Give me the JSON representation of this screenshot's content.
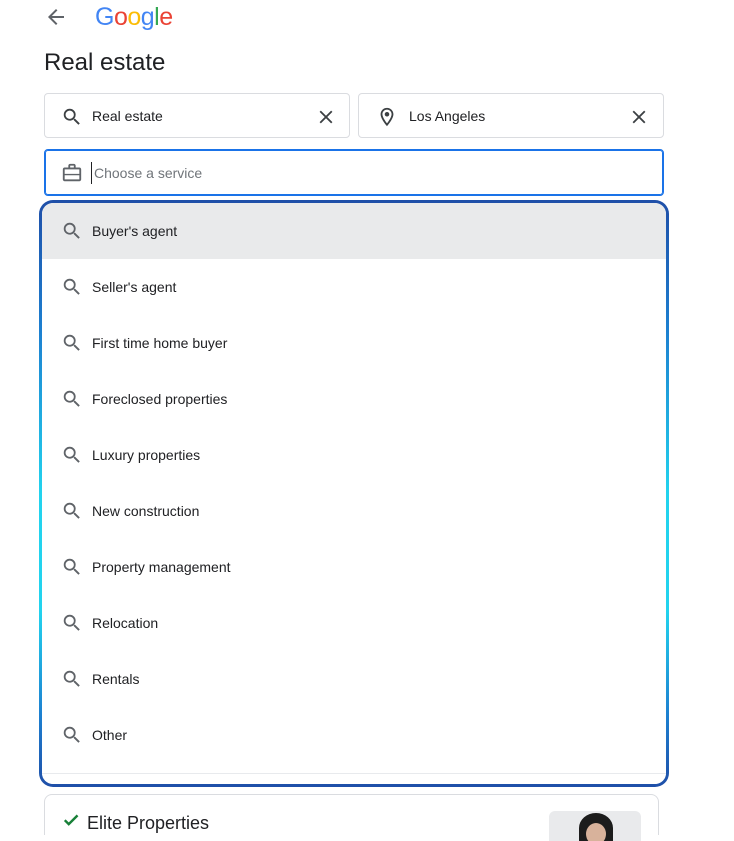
{
  "header": {
    "logo_letters": [
      {
        "ch": "G",
        "color": "#4285F4"
      },
      {
        "ch": "o",
        "color": "#EA4335"
      },
      {
        "ch": "o",
        "color": "#FBBC05"
      },
      {
        "ch": "g",
        "color": "#4285F4"
      },
      {
        "ch": "l",
        "color": "#34A853"
      },
      {
        "ch": "e",
        "color": "#EA4335"
      }
    ]
  },
  "page": {
    "title": "Real estate"
  },
  "search": {
    "category_value": "Real estate",
    "location_value": "Los Angeles",
    "service_placeholder": "Choose a service"
  },
  "dropdown": {
    "items": [
      {
        "label": "Buyer's agent"
      },
      {
        "label": "Seller's agent"
      },
      {
        "label": "First time home buyer"
      },
      {
        "label": "Foreclosed properties"
      },
      {
        "label": "Luxury properties"
      },
      {
        "label": "New construction"
      },
      {
        "label": "Property management"
      },
      {
        "label": "Relocation"
      },
      {
        "label": "Rentals"
      },
      {
        "label": "Other"
      }
    ]
  },
  "results": {
    "first_card_title": "Elite Properties"
  },
  "colors": {
    "accent": "#1a73e8",
    "check": "#188038",
    "icon": "#5f6368"
  }
}
